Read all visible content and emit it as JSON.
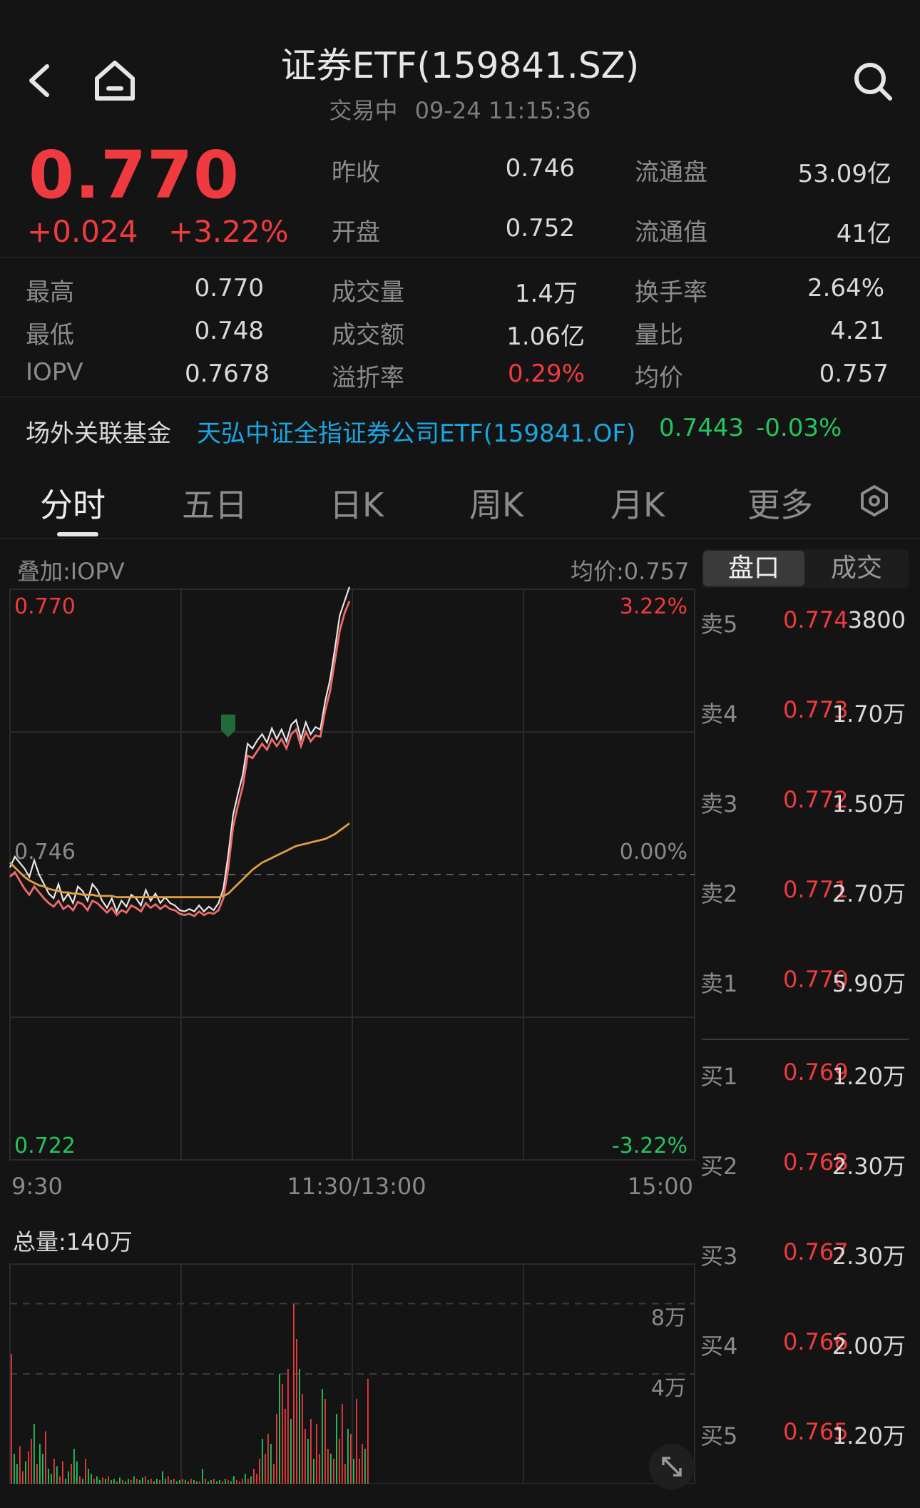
{
  "header": {
    "title": "证券ETF(159841.SZ)",
    "status": "交易中",
    "datetime": "09-24 11:15:36"
  },
  "quote": {
    "price": "0.770",
    "change": "+0.024",
    "change_pct": "+3.22%"
  },
  "stats_top": [
    {
      "label": "昨收",
      "value": "0.746"
    },
    {
      "label": "流通盘",
      "value": "53.09亿"
    },
    {
      "label": "开盘",
      "value": "0.752"
    },
    {
      "label": "流通值",
      "value": "41亿"
    }
  ],
  "stats_grid": [
    {
      "label": "最高",
      "value": "0.770"
    },
    {
      "label": "成交量",
      "value": "1.4万"
    },
    {
      "label": "换手率",
      "value": "2.64%"
    },
    {
      "label": "最低",
      "value": "0.748"
    },
    {
      "label": "成交额",
      "value": "1.06亿"
    },
    {
      "label": "量比",
      "value": "4.21"
    },
    {
      "label": "IOPV",
      "value": "0.7678"
    },
    {
      "label": "溢折率",
      "value": "0.29%"
    },
    {
      "label": "均价",
      "value": "0.757"
    }
  ],
  "related_fund": {
    "label": "场外关联基金",
    "name": "天弘中证全指证券公司ETF(159841.OF)",
    "price": "0.7443",
    "change": "-0.03%"
  },
  "tabs": [
    "分时",
    "五日",
    "日K",
    "周K",
    "月K",
    "更多"
  ],
  "chart_header": {
    "overlay": "叠加:IOPV",
    "avg": "均价:0.757"
  },
  "book_tabs": [
    "盘口",
    "成交"
  ],
  "order_book": {
    "asks": [
      {
        "label": "卖5",
        "price": "0.774",
        "vol": "3800"
      },
      {
        "label": "卖4",
        "price": "0.773",
        "vol": "1.70万"
      },
      {
        "label": "卖3",
        "price": "0.772",
        "vol": "1.50万"
      },
      {
        "label": "卖2",
        "price": "0.771",
        "vol": "2.70万"
      },
      {
        "label": "卖1",
        "price": "0.770",
        "vol": "5.90万"
      }
    ],
    "bids": [
      {
        "label": "买1",
        "price": "0.769",
        "vol": "1.20万"
      },
      {
        "label": "买2",
        "price": "0.768",
        "vol": "2.30万"
      },
      {
        "label": "买3",
        "price": "0.767",
        "vol": "2.30万"
      },
      {
        "label": "买4",
        "price": "0.766",
        "vol": "2.00万"
      },
      {
        "label": "买5",
        "price": "0.765",
        "vol": "1.20万"
      }
    ]
  },
  "colors": {
    "up": "#ef3b3f",
    "down": "#22c55e",
    "link": "#1aa6e0",
    "avg_line": "#e0a040",
    "price_line": "#e8e8e8",
    "iopv_line": "#ef6b6b"
  },
  "chart_data": [
    {
      "type": "line",
      "title": "",
      "y_labels_left": [
        "0.770",
        "0.746",
        "0.722"
      ],
      "y_labels_right": [
        "3.22%",
        "0.00%",
        "-3.22%"
      ],
      "x_labels": [
        "9:30",
        "11:30/13:00",
        "15:00"
      ],
      "ylim": [
        0.722,
        0.77
      ],
      "grid": true,
      "series": [
        {
          "values": [
            0.7466,
            0.7475,
            0.747,
            0.7465,
            0.7458,
            0.7472,
            0.746,
            0.7452,
            0.7444,
            0.744,
            0.7452,
            0.7438,
            0.7444,
            0.7436,
            0.745,
            0.7446,
            0.7438,
            0.7452,
            0.7447,
            0.7438,
            0.7432,
            0.744,
            0.7429,
            0.7438,
            0.7433,
            0.7443,
            0.744,
            0.7434,
            0.7447,
            0.7438,
            0.7444,
            0.7436,
            0.7441,
            0.7436,
            0.7434,
            0.743,
            0.7429,
            0.7431,
            0.7429,
            0.7434,
            0.7429,
            0.7433,
            0.743,
            0.7436,
            0.7448,
            0.7476,
            0.751,
            0.7528,
            0.7544,
            0.757,
            0.7566,
            0.7573,
            0.7578,
            0.7571,
            0.7583,
            0.7574,
            0.7582,
            0.7572,
            0.7586,
            0.759,
            0.7574,
            0.7588,
            0.7578,
            0.7584,
            0.7582,
            0.7606,
            0.7624,
            0.765,
            0.7678,
            0.769,
            0.7702
          ]
        },
        {
          "values": [
            0.7458,
            0.7462,
            0.7455,
            0.7448,
            0.7443,
            0.745,
            0.7445,
            0.744,
            0.7436,
            0.7433,
            0.7438,
            0.7431,
            0.7434,
            0.743,
            0.7437,
            0.7435,
            0.743,
            0.7438,
            0.7436,
            0.7432,
            0.7428,
            0.7432,
            0.7426,
            0.743,
            0.7428,
            0.7434,
            0.7432,
            0.7429,
            0.7436,
            0.7432,
            0.7435,
            0.7431,
            0.7434,
            0.7431,
            0.743,
            0.7427,
            0.7426,
            0.7427,
            0.7425,
            0.7429,
            0.7426,
            0.7428,
            0.7427,
            0.743,
            0.744,
            0.7465,
            0.75,
            0.7518,
            0.7534,
            0.756,
            0.7558,
            0.7564,
            0.757,
            0.7565,
            0.7574,
            0.7568,
            0.7574,
            0.7566,
            0.7578,
            0.7582,
            0.7568,
            0.758,
            0.7572,
            0.7577,
            0.7576,
            0.7598,
            0.7614,
            0.764,
            0.7665,
            0.768,
            0.769
          ]
        },
        {
          "values": [
            0.747,
            0.7466,
            0.7462,
            0.7458,
            0.7455,
            0.7453,
            0.7451,
            0.745,
            0.7448,
            0.7447,
            0.7446,
            0.7445,
            0.7445,
            0.7444,
            0.7444,
            0.7443,
            0.7443,
            0.7443,
            0.7442,
            0.7442,
            0.7442,
            0.7442,
            0.7441,
            0.7441,
            0.7441,
            0.7441,
            0.7441,
            0.7441,
            0.7441,
            0.7441,
            0.7441,
            0.7441,
            0.7441,
            0.7441,
            0.7441,
            0.7441,
            0.7441,
            0.7441,
            0.7441,
            0.7441,
            0.7441,
            0.7441,
            0.7441,
            0.7441,
            0.7442,
            0.7444,
            0.7448,
            0.7452,
            0.7456,
            0.746,
            0.7464,
            0.7467,
            0.747,
            0.7472,
            0.7474,
            0.7476,
            0.7478,
            0.748,
            0.7482,
            0.7484,
            0.7485,
            0.7486,
            0.7487,
            0.7488,
            0.7489,
            0.749,
            0.7492,
            0.7494,
            0.7497,
            0.75,
            0.7503
          ]
        }
      ]
    },
    {
      "type": "bar",
      "title": "总量:140万",
      "y_labels": [
        "8万",
        "4万"
      ],
      "ylim": [
        0,
        80000
      ],
      "grid": true,
      "values": [
        52000,
        12000,
        8000,
        15000,
        5000,
        9000,
        13000,
        18000,
        24000,
        8000,
        16000,
        12000,
        21000,
        6000,
        4000,
        10000,
        7000,
        3000,
        9000,
        2000,
        5000,
        8000,
        14000,
        9000,
        3000,
        2000,
        10000,
        6000,
        4000,
        2000,
        3000,
        1500,
        2500,
        2000,
        3000,
        1500,
        2000,
        1000,
        2500,
        1500,
        1000,
        2000,
        1500,
        3000,
        2000,
        1500,
        2500,
        3000,
        1500,
        2000,
        1000,
        2000,
        1500,
        5000,
        2000,
        3000,
        1500,
        2000,
        1000,
        1500,
        2000,
        1500,
        1000,
        2000,
        1500,
        1000,
        1000,
        6000,
        2000,
        1000,
        1500,
        2000,
        1000,
        1500,
        1000,
        2000,
        1500,
        1000,
        3000,
        1500,
        1000,
        2000,
        4000,
        2000,
        3000,
        6000,
        4000,
        10000,
        18000,
        12000,
        20000,
        16000,
        8000,
        28000,
        44000,
        40000,
        30000,
        46000,
        26000,
        72000,
        58000,
        46000,
        36000,
        22000,
        18000,
        26000,
        10000,
        24000,
        12000,
        38000,
        34000,
        14000,
        12000,
        10000,
        28000,
        18000,
        32000,
        8000,
        22000,
        20000,
        10000,
        34000,
        10000,
        16000,
        14000,
        42000
      ],
      "colors": [
        "r",
        "g",
        "g",
        "r",
        "r",
        "g",
        "r",
        "r",
        "g",
        "r",
        "g",
        "g",
        "r",
        "g",
        "g",
        "r",
        "g",
        "r",
        "r",
        "g",
        "g",
        "r",
        "g",
        "g",
        "r",
        "g",
        "r",
        "g",
        "g",
        "r",
        "g",
        "g",
        "r",
        "g",
        "r",
        "g",
        "g",
        "r",
        "g",
        "r",
        "g",
        "g",
        "r",
        "g",
        "r",
        "g",
        "g",
        "r",
        "g",
        "r",
        "g",
        "g",
        "r",
        "g",
        "g",
        "r",
        "g",
        "r",
        "g",
        "g",
        "r",
        "g",
        "g",
        "r",
        "g",
        "g",
        "r",
        "g",
        "r",
        "g",
        "g",
        "r",
        "g",
        "g",
        "r",
        "g",
        "r",
        "g",
        "g",
        "r",
        "r",
        "r",
        "g",
        "r",
        "g",
        "r",
        "r",
        "r",
        "g",
        "r",
        "r",
        "g",
        "r",
        "r",
        "g",
        "r",
        "r",
        "r",
        "g",
        "r",
        "r",
        "g",
        "r",
        "r",
        "g",
        "r",
        "g",
        "r",
        "r",
        "g",
        "r",
        "r",
        "g",
        "r",
        "g",
        "r",
        "r",
        "r",
        "g",
        "r",
        "g",
        "r",
        "r",
        "r",
        "g",
        "r"
      ]
    }
  ]
}
